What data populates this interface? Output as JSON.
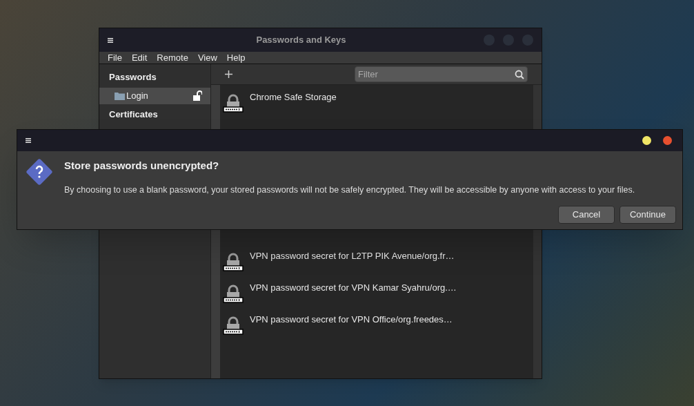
{
  "main_window": {
    "title": "Passwords and Keys",
    "menu": [
      "File",
      "Edit",
      "Remote",
      "View",
      "Help"
    ],
    "sidebar": {
      "sections": [
        {
          "heading": "Passwords",
          "items": [
            {
              "label": "Login",
              "selected": true,
              "locked": false
            }
          ]
        },
        {
          "heading": "Certificates"
        }
      ]
    },
    "filter": {
      "placeholder": "Filter"
    },
    "list_above_dialog": [
      {
        "name": "Chrome Safe Storage"
      }
    ],
    "list_below_dialog": [
      {
        "name": "VPN password secret for L2TP PIK Avenue/org.fr…"
      },
      {
        "name": "VPN password secret for VPN Kamar Syahru/org.…"
      },
      {
        "name": "VPN password secret for VPN Office/org.freedes…"
      }
    ]
  },
  "dialog": {
    "title": "Store passwords unencrypted?",
    "message": "By choosing to use a blank password, your stored passwords will not be safely encrypted. They will be accessible by anyone with access to your files.",
    "buttons": [
      "Cancel",
      "Continue"
    ]
  }
}
